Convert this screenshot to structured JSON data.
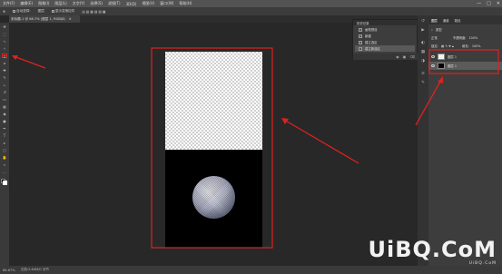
{
  "menubar": {
    "items": [
      "文件(F)",
      "编辑(E)",
      "图像(I)",
      "图层(L)",
      "文字(Y)",
      "选择(S)",
      "滤镜(T)",
      "3D(D)",
      "视图(V)",
      "窗口(W)",
      "帮助(H)"
    ],
    "window_controls": [
      "—",
      "□",
      "✕"
    ]
  },
  "options_bar": {
    "items": [
      "自动选择:",
      "图层",
      "显示变换控件"
    ]
  },
  "document_tab": {
    "title": "未标题-1 @ 66.7% (图层 1, RGB/8)",
    "close": "✕"
  },
  "history_panel": {
    "title": "历史记录",
    "items": [
      "画笔预设",
      "新建",
      "建立选区",
      "建立新选区"
    ],
    "footer_icons": [
      "camera-icon",
      "new-doc-icon",
      "trash-icon"
    ]
  },
  "layers_panel": {
    "tabs": [
      "图层",
      "通道",
      "路径"
    ],
    "kind_label": "类型",
    "blend_mode": "正常",
    "opacity_label": "不透明度:",
    "opacity_value": "100%",
    "lock_label": "锁定:",
    "fill_label": "填充:",
    "fill_value": "100%",
    "layers": [
      {
        "name": "图层 1"
      },
      {
        "name": "图层 1"
      }
    ]
  },
  "statusbar": {
    "zoom": "66.67%",
    "doc_info": "文档:2.64M/0 字节"
  },
  "watermark": {
    "logo": "UiBQ.CoM",
    "sub": "UiBQ.CoM"
  },
  "colors": {
    "annotation_red": "#e02020",
    "canvas_bg": "#282828",
    "panel_bg": "#3d3d3d"
  }
}
